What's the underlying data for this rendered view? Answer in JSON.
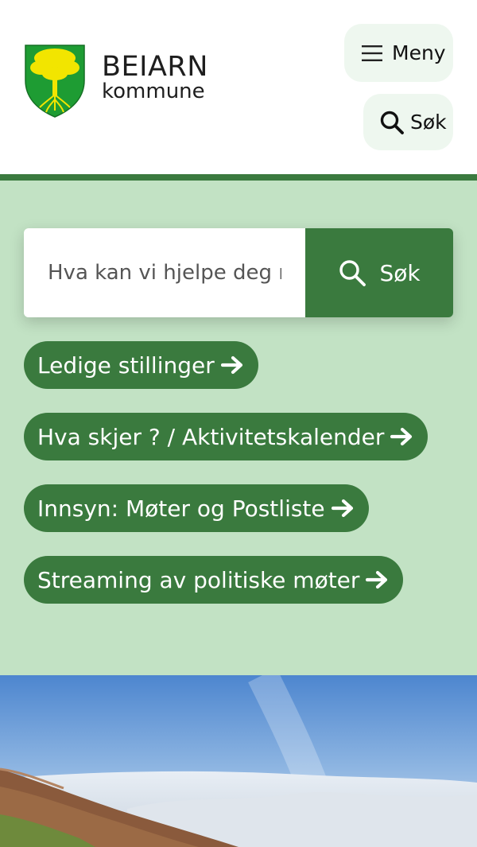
{
  "brand": {
    "name": "BEIARN",
    "sub": "kommune"
  },
  "header": {
    "menu_label": "Meny",
    "search_label": "Søk"
  },
  "search": {
    "placeholder": "Hva kan vi hjelpe deg med?",
    "button_label": "Søk"
  },
  "quick_links": [
    {
      "label": "Ledige stillinger"
    },
    {
      "label": "Hva skjer ? / Aktivitetskalender"
    },
    {
      "label": "Innsyn: Møter og Postliste"
    },
    {
      "label": "Streaming av politiske møter"
    }
  ],
  "colors": {
    "accent": "#3a7a3e",
    "hero_bg": "#c2e2c4",
    "header_btn_bg": "#eef7ef"
  },
  "icons": {
    "menu": "hamburger-icon",
    "search": "magnifier-icon",
    "link": "arrow-right-icon"
  }
}
